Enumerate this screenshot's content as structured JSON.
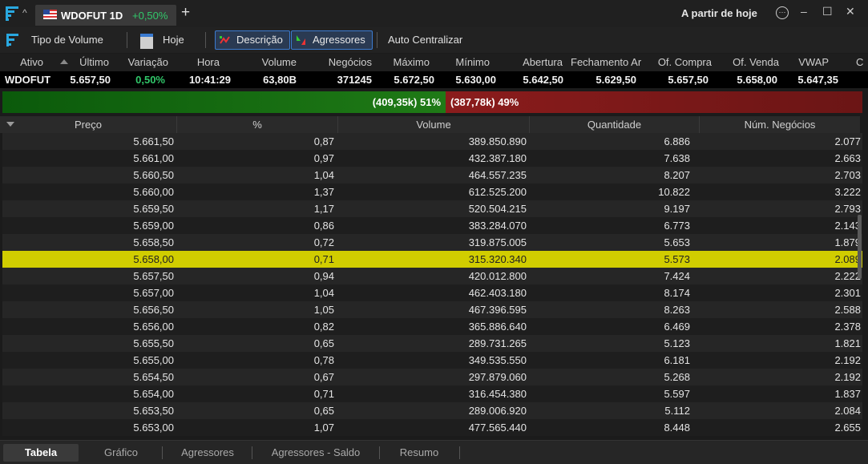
{
  "window": {
    "tab_title": "WDOFUT 1D",
    "tab_change": "+0,50%",
    "new_tab": "+",
    "time_mode": "A partir de hoje",
    "controls": {
      "menu": "⋯",
      "minimize": "–",
      "maximize": "☐",
      "close": "✕"
    }
  },
  "toolbar": {
    "volume_type": "Tipo de Volume",
    "today": "Hoje",
    "description": "Descrição",
    "aggressors": "Agressores",
    "auto_center": "Auto Centralizar"
  },
  "quote": {
    "headers": [
      "Ativo",
      "Último",
      "Variação",
      "Hora",
      "Volume",
      "Negócios",
      "Máximo",
      "Mínimo",
      "Abertura",
      "Fechamento Ar",
      "Of. Compra",
      "Of. Venda",
      "VWAP",
      "C"
    ],
    "values": [
      "WDOFUT",
      "5.657,50",
      "0,50%",
      "10:41:29",
      "63,80B",
      "371245",
      "5.672,50",
      "5.630,00",
      "5.642,50",
      "5.629,50",
      "5.657,50",
      "5.658,00",
      "5.647,35"
    ]
  },
  "aggression": {
    "buy_label": "(409,35k) 51%",
    "sell_label": "(387,78k) 49%",
    "buy_percent": 51,
    "buy_color": "#1f7a16",
    "sell_color": "#8b1c1c"
  },
  "table": {
    "columns": [
      "Preço",
      "%",
      "Volume",
      "Quantidade",
      "Núm. Negócios"
    ],
    "highlight_color": "#d1cd00",
    "rows": [
      [
        "5.661,50",
        "0,87",
        "389.850.890",
        "6.886",
        "2.077"
      ],
      [
        "5.661,00",
        "0,97",
        "432.387.180",
        "7.638",
        "2.663"
      ],
      [
        "5.660,50",
        "1,04",
        "464.557.235",
        "8.207",
        "2.703"
      ],
      [
        "5.660,00",
        "1,37",
        "612.525.200",
        "10.822",
        "3.222"
      ],
      [
        "5.659,50",
        "1,17",
        "520.504.215",
        "9.197",
        "2.793"
      ],
      [
        "5.659,00",
        "0,86",
        "383.284.070",
        "6.773",
        "2.143"
      ],
      [
        "5.658,50",
        "0,72",
        "319.875.005",
        "5.653",
        "1.879"
      ],
      [
        "5.658,00",
        "0,71",
        "315.320.340",
        "5.573",
        "2.089"
      ],
      [
        "5.657,50",
        "0,94",
        "420.012.800",
        "7.424",
        "2.222"
      ],
      [
        "5.657,00",
        "1,04",
        "462.403.180",
        "8.174",
        "2.301"
      ],
      [
        "5.656,50",
        "1,05",
        "467.396.595",
        "8.263",
        "2.588"
      ],
      [
        "5.656,00",
        "0,82",
        "365.886.640",
        "6.469",
        "2.378"
      ],
      [
        "5.655,50",
        "0,65",
        "289.731.265",
        "5.123",
        "1.821"
      ],
      [
        "5.655,00",
        "0,78",
        "349.535.550",
        "6.181",
        "2.192"
      ],
      [
        "5.654,50",
        "0,67",
        "297.879.060",
        "5.268",
        "2.192"
      ],
      [
        "5.654,00",
        "0,71",
        "316.454.380",
        "5.597",
        "1.837"
      ],
      [
        "5.653,50",
        "0,65",
        "289.006.920",
        "5.112",
        "2.084"
      ],
      [
        "5.653,00",
        "1,07",
        "477.565.440",
        "8.448",
        "2.655"
      ]
    ]
  },
  "bottom_tabs": [
    "Tabela",
    "Gráfico",
    "Agressores",
    "Agressores - Saldo",
    "Resumo"
  ]
}
